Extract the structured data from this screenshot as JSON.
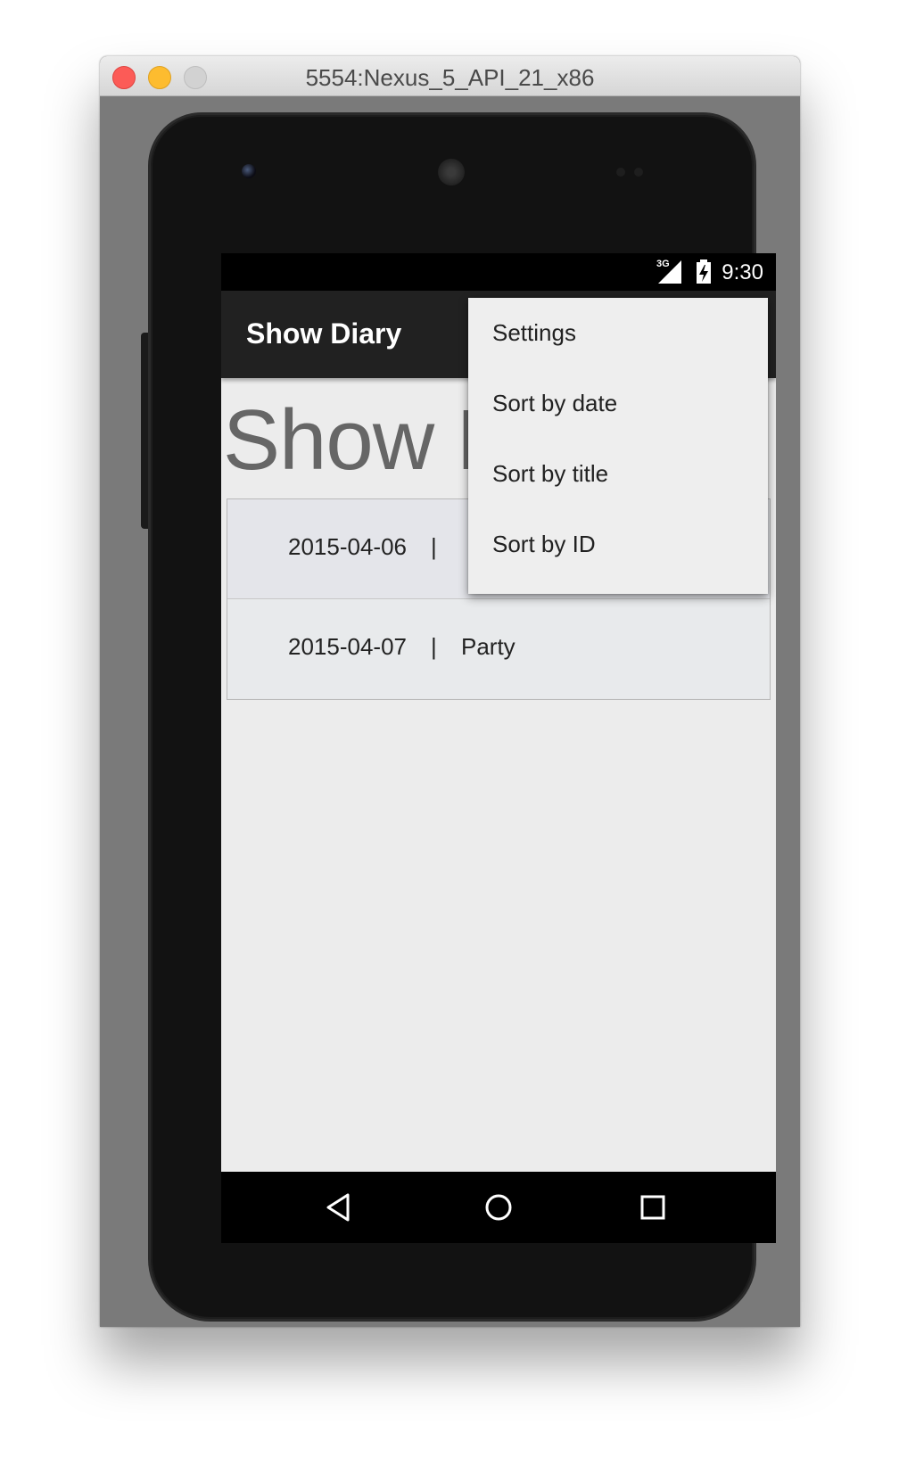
{
  "window": {
    "title": "5554:Nexus_5_API_21_x86"
  },
  "status_bar": {
    "network": "3G",
    "time": "9:30"
  },
  "action_bar": {
    "title": "Show Diary"
  },
  "page": {
    "heading": "Show D"
  },
  "entries": [
    {
      "date": "2015-04-06",
      "separator": "|",
      "title": ""
    },
    {
      "date": "2015-04-07",
      "separator": "|",
      "title": "Party"
    }
  ],
  "menu": {
    "items": [
      "Settings",
      "Sort by date",
      "Sort by title",
      "Sort by ID"
    ]
  },
  "nav": {
    "back": "back-icon",
    "home": "home-icon",
    "recents": "recents-icon"
  },
  "colors": {
    "action_bar": "#212121",
    "screen_bg": "#ececec",
    "menu_bg": "#eeeeee"
  }
}
